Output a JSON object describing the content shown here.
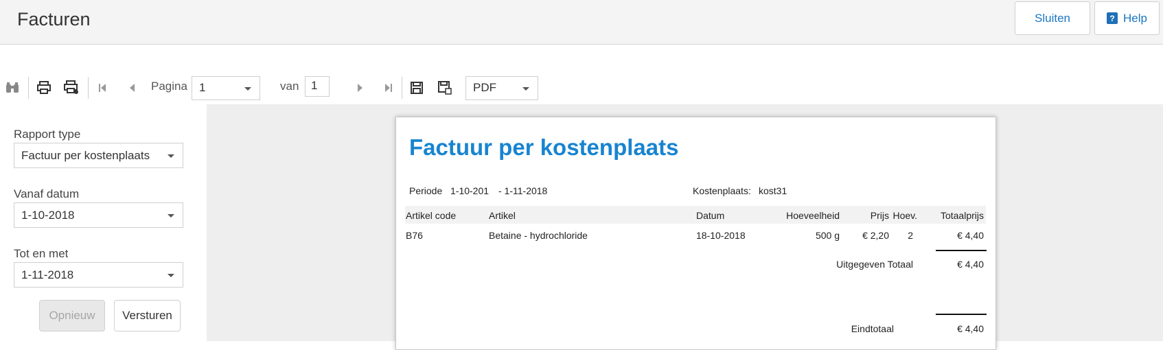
{
  "header": {
    "title": "Facturen",
    "close_label": "Sluiten",
    "help_label": "Help"
  },
  "toolbar": {
    "page_label": "Pagina",
    "page_value": "1",
    "of_label": "van",
    "total_pages": "1",
    "export_format": "PDF",
    "icons": [
      "binoculars-icon",
      "print-icon",
      "print-preview-icon",
      "first-page-icon",
      "previous-page-icon",
      "next-page-icon",
      "last-page-icon",
      "save-icon",
      "save-as-icon"
    ]
  },
  "filters": {
    "report_type_label": "Rapport type",
    "report_type_value": "Factuur per kostenplaats",
    "from_date_label": "Vanaf datum",
    "from_date_value": "1-10-2018",
    "to_date_label": "Tot en met",
    "to_date_value": "1-11-2018",
    "renew_label": "Opnieuw",
    "send_label": "Versturen"
  },
  "report": {
    "title": "Factuur per kostenplaats",
    "period_label": "Periode",
    "period_from": "1-10-201",
    "period_to": "- 1-11-2018",
    "costcenter_label": "Kostenplaats:",
    "costcenter_value": "kost31",
    "columns": [
      "Artikel code",
      "Artikel",
      "Datum",
      "Hoeveelheid",
      "Prijs",
      "Hoev.",
      "Totaalprijs"
    ],
    "rows": [
      {
        "code": "B76",
        "article": "Betaine - hydrochloride",
        "date": "18-10-2018",
        "quantity": "500 g",
        "price": "€ 2,20",
        "count": "2",
        "total": "€ 4,40"
      }
    ],
    "subtotal_label": "Uitgegeven Totaal",
    "subtotal_value": "€ 4,40",
    "grandtotal_label": "Eindtotaal",
    "grandtotal_value": "€ 4,40"
  }
}
